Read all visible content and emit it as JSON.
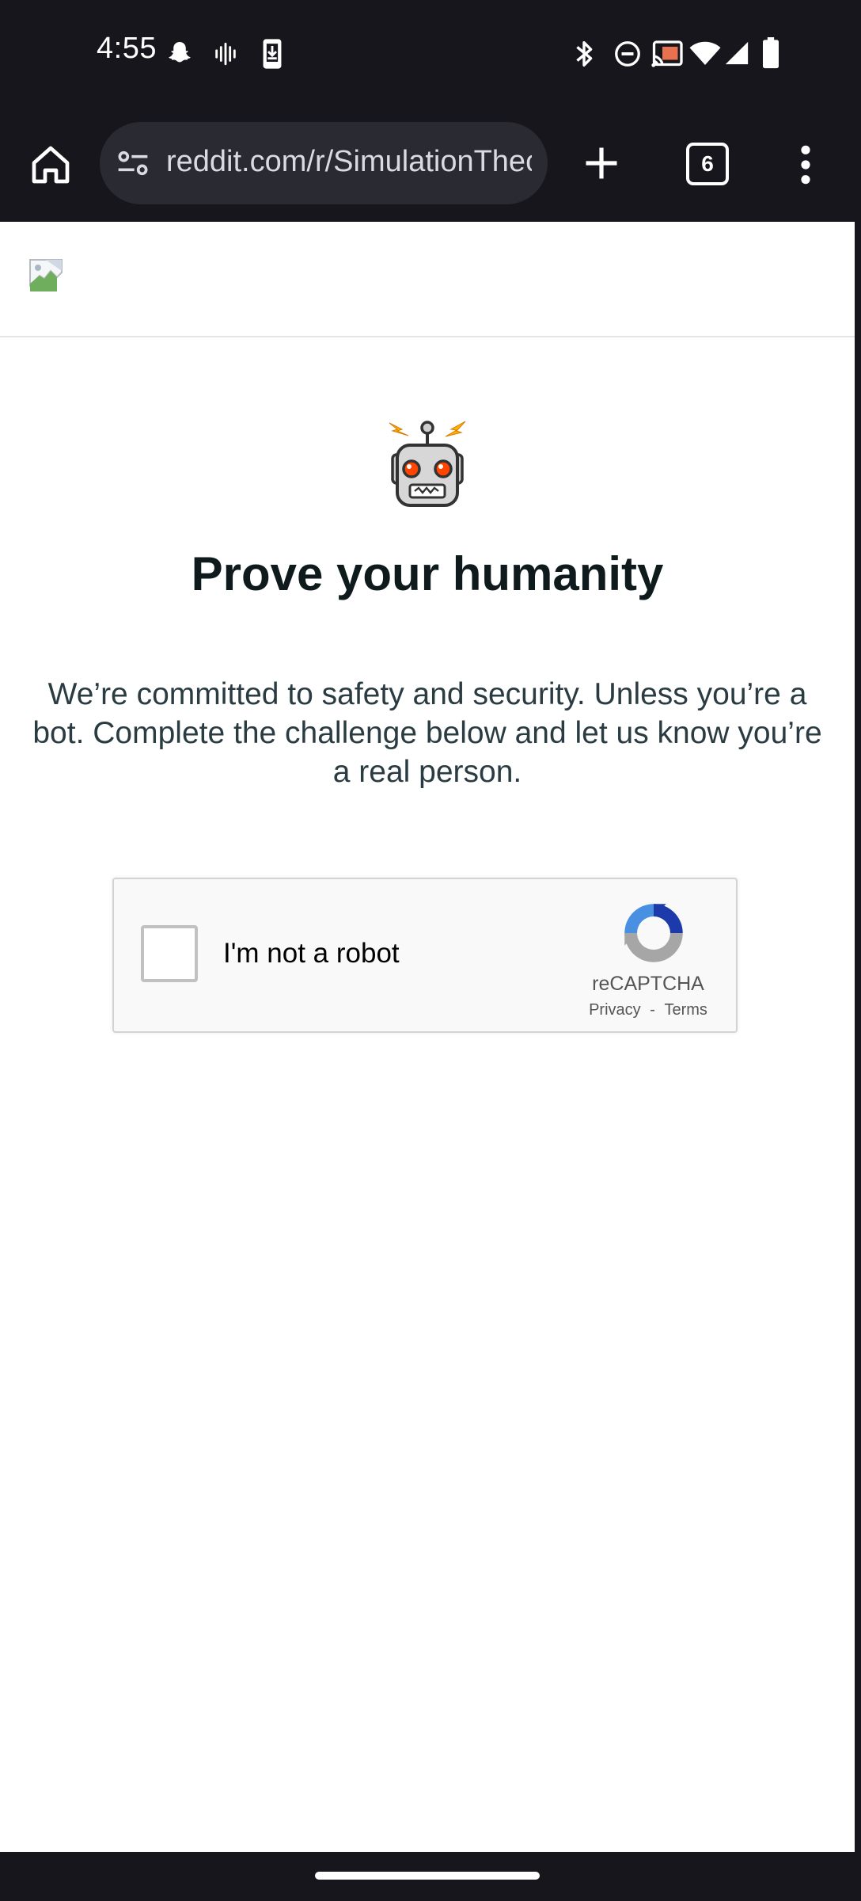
{
  "status_bar": {
    "time": "4:55",
    "left_icons": [
      "snapchat-icon",
      "sound-wave-icon",
      "download-phone-icon"
    ],
    "right_icons": [
      "bluetooth-icon",
      "do-not-disturb-icon",
      "cast-icon",
      "wifi-icon",
      "cell-signal-icon",
      "battery-icon"
    ]
  },
  "browser": {
    "url": "reddit.com/r/SimulationTheory",
    "tab_count": "6",
    "icons": [
      "home-icon",
      "site-settings-icon",
      "new-tab-icon",
      "tab-switcher-icon",
      "more-menu-icon"
    ]
  },
  "page": {
    "header_image": "broken-image-icon",
    "mascot": "reddit-robot-icon",
    "heading": "Prove your humanity",
    "body": "We’re committed to safety and security. Unless you’re a bot. Complete the challenge below and let us know you’re a real person."
  },
  "recaptcha": {
    "label": "I'm not a robot",
    "brand": "reCAPTCHA",
    "privacy": "Privacy",
    "separator": "-",
    "terms": "Terms"
  },
  "colors": {
    "system_bar_bg": "#16161c",
    "url_pill_bg": "#2a2a33",
    "heading": "#0f1a1c",
    "body_text": "#2a3c42",
    "recaptcha_bg": "#f9f9f9",
    "recaptcha_blue": "#1c3aa9",
    "recaptcha_grey": "#a6a6a6"
  }
}
